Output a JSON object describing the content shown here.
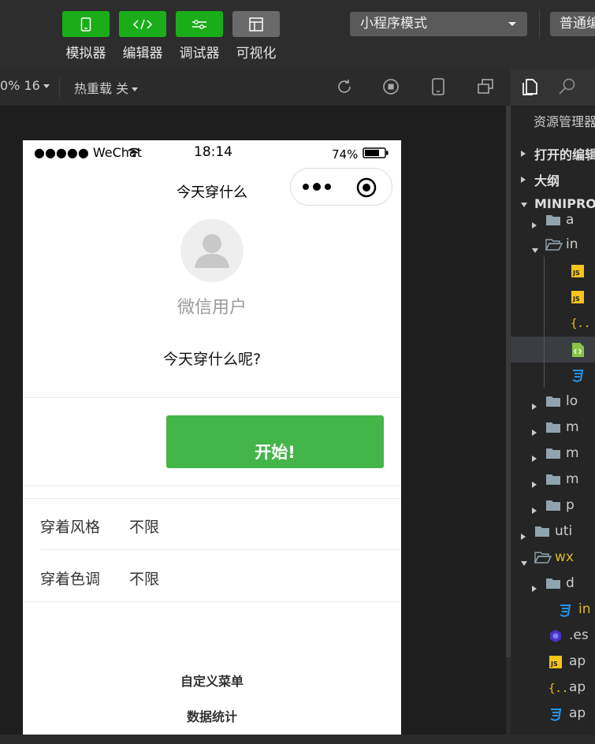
{
  "toolbar": {
    "buttons": [
      {
        "label": "模拟器",
        "icon": "phone-icon",
        "color": "#1aad19"
      },
      {
        "label": "编辑器",
        "icon": "code-icon",
        "color": "#1aad19"
      },
      {
        "label": "调试器",
        "icon": "debug-icon",
        "color": "#1aad19"
      },
      {
        "label": "可视化",
        "icon": "layout-icon",
        "color": "#6a6a6a"
      }
    ],
    "mode_select": "小程序模式",
    "mode_right": "普通编译"
  },
  "subbar": {
    "zoom": "0% 16",
    "hot_reload": "热重载 关"
  },
  "phone": {
    "status_carrier": "●●●●● WeChat",
    "status_time": "18:14",
    "status_battery": "74%",
    "nav_title": "今天穿什么",
    "username": "微信用户",
    "question": "今天穿什么呢?",
    "start_button": "开始!",
    "rows": [
      {
        "label": "穿着风格",
        "value": "不限"
      },
      {
        "label": "穿着色调",
        "value": "不限"
      }
    ],
    "menu": [
      "自定义菜单",
      "数据统计"
    ]
  },
  "explorer": {
    "title": "资源管理器",
    "sections": [
      "打开的编辑器",
      "大纲",
      "MINIPROGRAM"
    ],
    "tree": [
      {
        "label": "a",
        "kind": "folder"
      },
      {
        "label": "in",
        "kind": "folder-open"
      },
      {
        "label": "",
        "kind": "js"
      },
      {
        "label": "",
        "kind": "js"
      },
      {
        "label": "",
        "kind": "json"
      },
      {
        "label": "",
        "kind": "wxml"
      },
      {
        "label": "",
        "kind": "wxss"
      },
      {
        "label": "lo",
        "kind": "folder"
      },
      {
        "label": "m",
        "kind": "folder"
      },
      {
        "label": "m",
        "kind": "folder"
      },
      {
        "label": "m",
        "kind": "folder"
      },
      {
        "label": "p",
        "kind": "folder"
      },
      {
        "label": "uti",
        "kind": "folder"
      },
      {
        "label": "wx",
        "kind": "folder-open"
      },
      {
        "label": "d",
        "kind": "folder"
      },
      {
        "label": "in",
        "kind": "wxss"
      },
      {
        "label": ".es",
        "kind": "eslint"
      },
      {
        "label": "ap",
        "kind": "js"
      },
      {
        "label": "ap",
        "kind": "json"
      },
      {
        "label": "ap",
        "kind": "wxss"
      }
    ]
  },
  "colors": {
    "accent": "#1aad19",
    "start_button": "#44b549",
    "background": "#2b2b2b"
  }
}
